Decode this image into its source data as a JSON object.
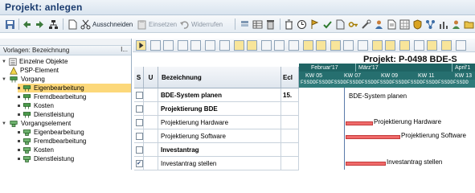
{
  "window": {
    "title": "Projekt: anlegen"
  },
  "toolbar": {
    "ausschneiden": "Ausschneiden",
    "einsetzen": "Einsetzen",
    "widerrufen": "Widerrufen"
  },
  "left_panel": {
    "header": "Vorlagen: Bezeichnung",
    "more": "I...",
    "tree": [
      {
        "label": "Einzelne Objekte",
        "icon": "list-icon"
      },
      {
        "label": "PSP-Element",
        "icon": "triangle-icon"
      },
      {
        "label": "Vorgang",
        "icon": "activity-icon"
      },
      {
        "label": "Eigenbearbeitung",
        "icon": "bullet"
      },
      {
        "label": "Fremdbearbeitung",
        "icon": "bullet"
      },
      {
        "label": "Kosten",
        "icon": "bullet"
      },
      {
        "label": "Dienstleistung",
        "icon": "bullet"
      },
      {
        "label": "Vorgangselement",
        "icon": "activity-element-icon"
      },
      {
        "label": "Eigenbearbeitung",
        "icon": "bullet"
      },
      {
        "label": "Fremdbearbeitung",
        "icon": "bullet"
      },
      {
        "label": "Kosten",
        "icon": "bullet"
      },
      {
        "label": "Dienstleistung",
        "icon": "bullet"
      }
    ]
  },
  "project": {
    "title": "Projekt: P-0498  BDE-S"
  },
  "grid": {
    "headers": {
      "s": "S",
      "u": "U",
      "bezeichnung": "Bezeichnung",
      "ecl": "Ecl"
    },
    "rows": [
      {
        "name": "BDE-System planen",
        "ecl": "15.",
        "bold": true,
        "checked": false
      },
      {
        "name": "Projektierung BDE",
        "ecl": "",
        "bold": true,
        "checked": false
      },
      {
        "name": "Projektierung Hardware",
        "ecl": "",
        "bold": false,
        "checked": false
      },
      {
        "name": "Projektierung Software",
        "ecl": "",
        "bold": false,
        "checked": false
      },
      {
        "name": "Investantrag",
        "ecl": "",
        "bold": true,
        "checked": false
      },
      {
        "name": "Investantrag stellen",
        "ecl": "",
        "bold": false,
        "checked": true
      }
    ]
  },
  "timeline": {
    "months": [
      "Februar'17",
      "März'17",
      "April'1"
    ],
    "weeks": [
      "KW 05",
      "KW 07",
      "KW 09",
      "KW 11",
      "KW 13"
    ],
    "days": "FSSDDFSSDDFSSDDFSSDDFSSDDFSSDDFSSDDFSSDDFSSDDFSSDDFSSDD",
    "bars": [
      {
        "label": "BDE-System planen"
      },
      {
        "label": "Projektierung Hardware"
      },
      {
        "label": "Projektierung Software"
      },
      {
        "label": "Investantrag stellen"
      }
    ],
    "colors": {
      "bar": "#f06a6a",
      "header": "#1f6464",
      "accent": "#2f7b7a"
    }
  }
}
